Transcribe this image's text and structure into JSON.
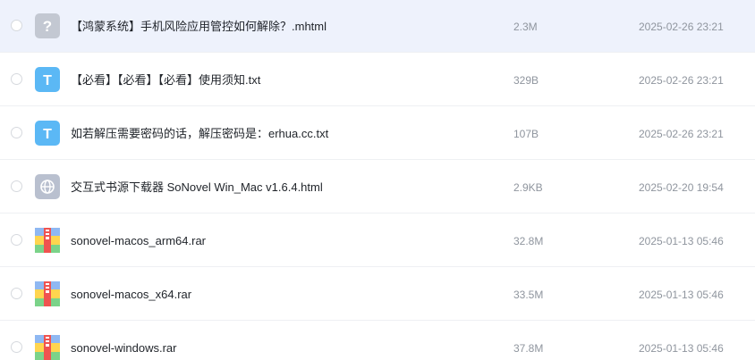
{
  "files": [
    {
      "icon": "unknown-file-icon",
      "name": "【鸿蒙系统】手机风险应用管控如何解除？.mhtml",
      "size": "2.3M",
      "date": "2025-02-26 23:21",
      "selected": true
    },
    {
      "icon": "text-file-icon",
      "name": "【必看】【必看】【必看】使用须知.txt",
      "size": "329B",
      "date": "2025-02-26 23:21"
    },
    {
      "icon": "text-file-icon",
      "name": "如若解压需要密码的话，解压密码是：erhua.cc.txt",
      "size": "107B",
      "date": "2025-02-26 23:21"
    },
    {
      "icon": "web-file-icon",
      "name": "交互式书源下载器 SoNovel Win_Mac v1.6.4.html",
      "size": "2.9KB",
      "date": "2025-02-20 19:54"
    },
    {
      "icon": "archive-file-icon",
      "name": "sonovel-macos_arm64.rar",
      "size": "32.8M",
      "date": "2025-01-13 05:46"
    },
    {
      "icon": "archive-file-icon",
      "name": "sonovel-macos_x64.rar",
      "size": "33.5M",
      "date": "2025-01-13 05:46"
    },
    {
      "icon": "archive-file-icon",
      "name": "sonovel-windows.rar",
      "size": "37.8M",
      "date": "2025-01-13 05:46"
    }
  ],
  "icon_glyphs": {
    "unknown": "?",
    "text": "T"
  },
  "colors": {
    "selected_row": "#eef2fc",
    "text_icon": "#5bb8f5",
    "unknown_icon": "#c3c8d2",
    "web_icon": "#b9c0cf",
    "archive_red": "#ef5350",
    "archive_yellow": "#ffd54f",
    "archive_green": "#7bd389",
    "archive_blue": "#8fb8f2"
  }
}
